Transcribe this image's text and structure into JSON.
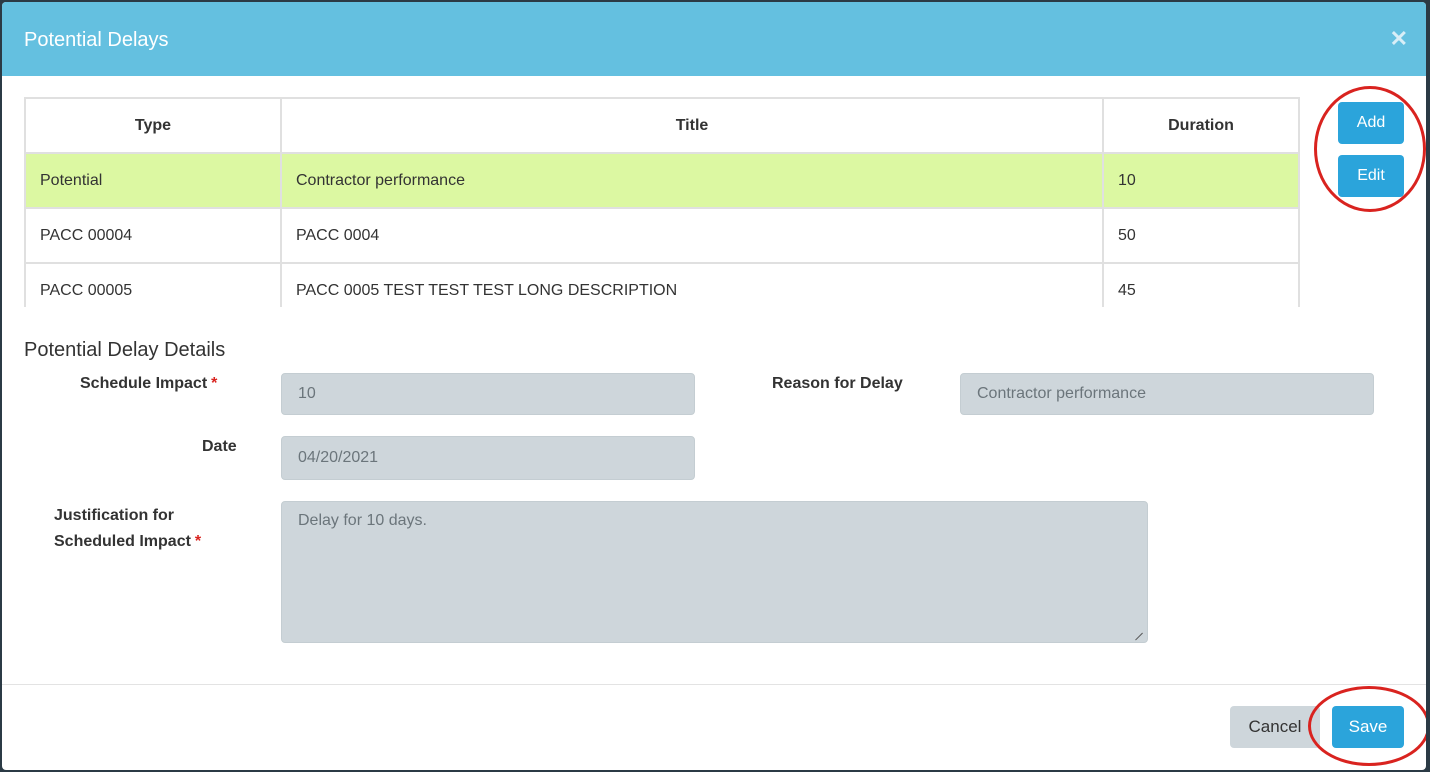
{
  "modal": {
    "title": "Potential Delays",
    "close_icon": "close-icon"
  },
  "table": {
    "headers": [
      "Type",
      "Title",
      "Duration"
    ],
    "rows": [
      {
        "type": "Potential",
        "title": "Contractor performance",
        "duration": "10",
        "selected": true
      },
      {
        "type": "PACC 00004",
        "title": "PACC 0004",
        "duration": "50",
        "selected": false
      },
      {
        "type": "PACC 00005",
        "title": "PACC 0005 TEST TEST TEST LONG DESCRIPTION",
        "duration": "45",
        "selected": false
      }
    ],
    "add_label": "Add",
    "edit_label": "Edit"
  },
  "details": {
    "section_title": "Potential Delay Details",
    "schedule_impact_label": "Schedule Impact",
    "schedule_impact_value": "10",
    "reason_label": "Reason for Delay",
    "reason_value": "Contractor performance",
    "date_label": "Date",
    "date_value": "04/20/2021",
    "justification_label_line1": "Justification for",
    "justification_label_line2": "Scheduled Impact",
    "justification_value": "Delay for 10 days.",
    "required_marker": "*"
  },
  "footer": {
    "cancel_label": "Cancel",
    "save_label": "Save"
  },
  "colors": {
    "header_bg": "#64c0e0",
    "selected_row": "#dcf8a2",
    "primary": "#2ba4db",
    "annotation_ring": "#d9231f"
  }
}
